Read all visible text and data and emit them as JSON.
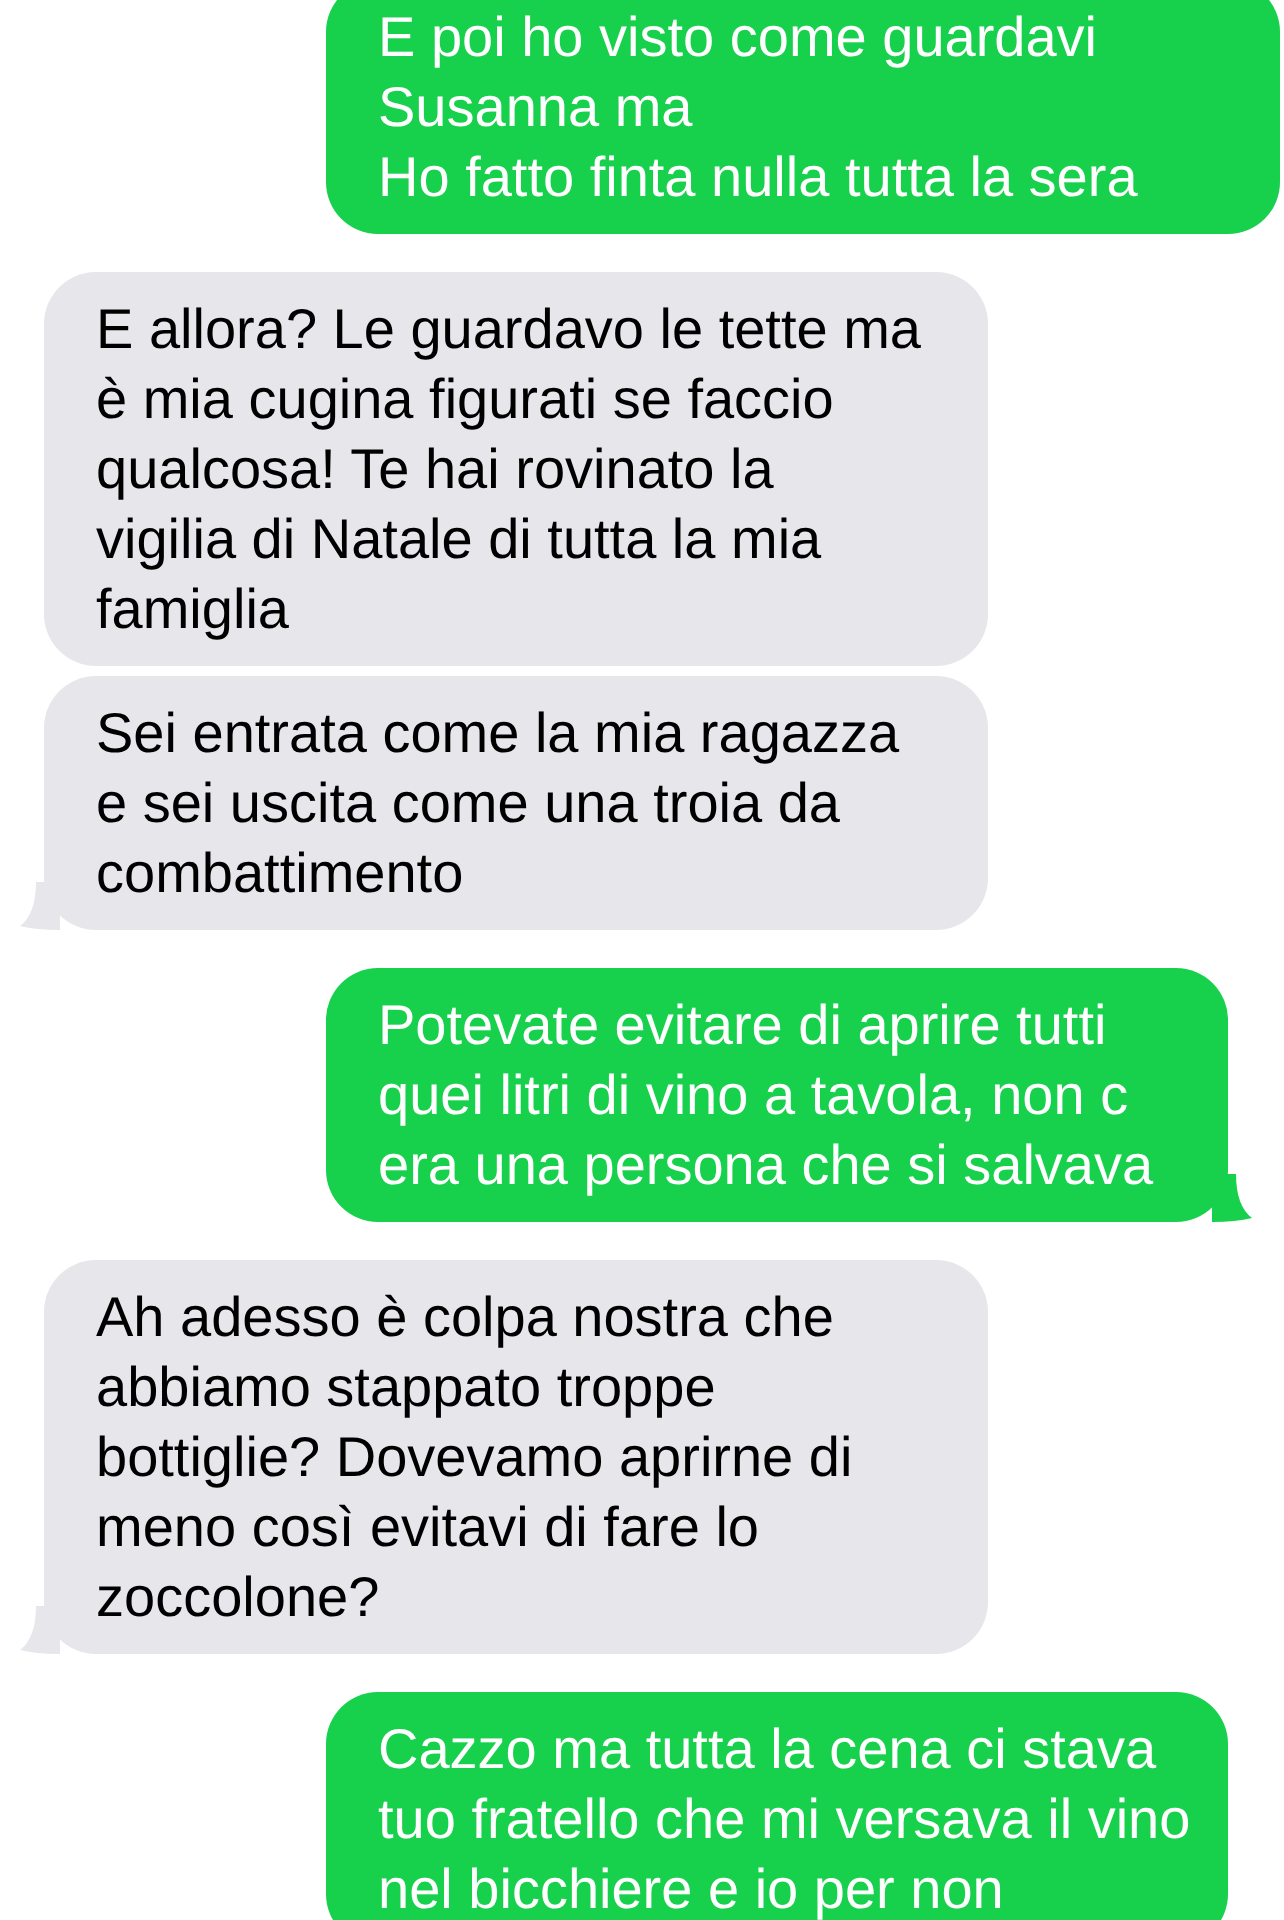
{
  "messages": [
    {
      "kind": "sent",
      "text": "E poi ho visto come guardavi Susanna ma\nHo fatto finta nulla tutta la sera"
    },
    {
      "kind": "received",
      "text": "E allora? Le guardavo le tette ma è mia cugina figurati se faccio qualcosa! Te hai rovinato la vigilia di Natale di tutta la mia famiglia"
    },
    {
      "kind": "received",
      "text": "Sei entrata come la mia ragazza e sei uscita come una troia da combattimento"
    },
    {
      "kind": "sent",
      "text": "Potevate evitare di aprire tutti quei litri di vino a tavola, non c era una persona che si salvava"
    },
    {
      "kind": "received",
      "text": "Ah adesso è colpa nostra che abbiamo stappato troppe bottiglie? Dovevamo aprirne di meno così evitavi di fare lo zoccolone?"
    },
    {
      "kind": "sent",
      "text": "Cazzo ma tutta la cena ci stava tuo fratello che mi versava il vino nel bicchiere e io per non"
    }
  ]
}
